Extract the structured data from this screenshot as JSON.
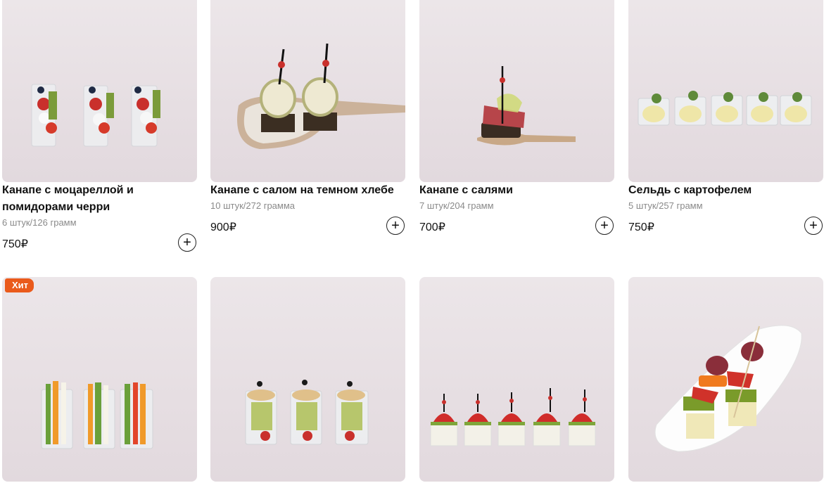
{
  "products": [
    {
      "title": "Канапе с моцареллой и помидорами черри",
      "weight": "6 штук/126 грамм",
      "price": "750₽",
      "add_label": "+"
    },
    {
      "title": "Канапе с салом на темном хлебе",
      "weight": "10 штук/272 грамма",
      "price": "900₽",
      "add_label": "+"
    },
    {
      "title": "Канапе с салями",
      "weight": "7 штук/204 грамм",
      "price": "700₽",
      "add_label": "+"
    },
    {
      "title": "Сельдь с картофелем",
      "weight": "5 штук/257 грамм",
      "price": "750₽",
      "add_label": "+"
    },
    {
      "badge": "Хит"
    },
    {},
    {},
    {}
  ],
  "colors": {
    "badge": "#ea5a1b",
    "photo_bg": "#e6dee2"
  },
  "icons": {
    "add": "plus-circle-icon"
  }
}
